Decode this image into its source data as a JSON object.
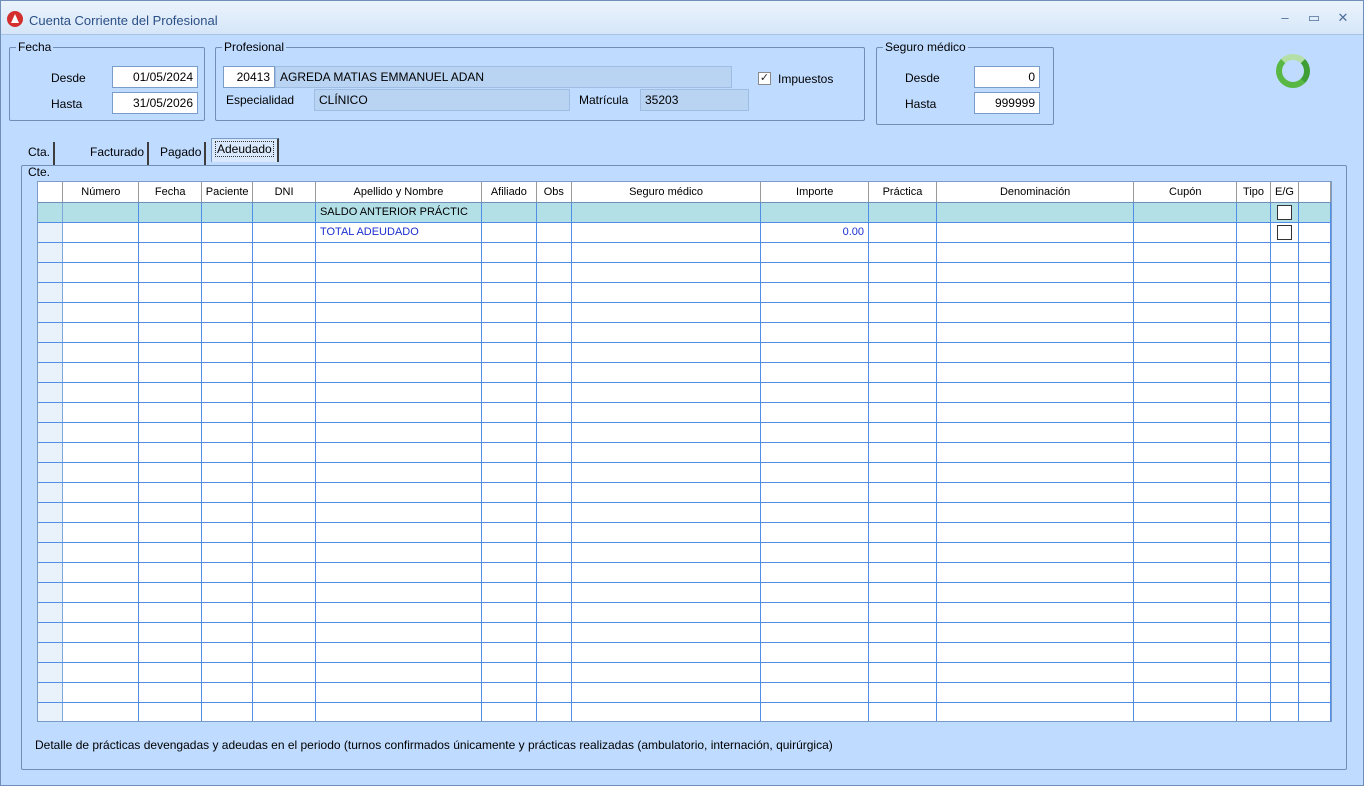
{
  "window": {
    "title": "Cuenta Corriente del Profesional",
    "controls": {
      "minimize": "–",
      "maximize": "▭",
      "close": "✕"
    }
  },
  "fecha": {
    "title": "Fecha",
    "desde_label": "Desde",
    "desde_value": "01/05/2024",
    "hasta_label": "Hasta",
    "hasta_value": "31/05/2026"
  },
  "profesional": {
    "title": "Profesional",
    "codigo": "20413",
    "nombre": "AGREDA MATIAS EMMANUEL ADAN",
    "impuestos_label": "Impuestos",
    "impuestos_checked": true,
    "especialidad_label": "Especialidad",
    "especialidad_value": "CLÍNICO",
    "matricula_label": "Matrícula",
    "matricula_value": "35203"
  },
  "seguro": {
    "title": "Seguro médico",
    "desde_label": "Desde",
    "desde_value": "0",
    "hasta_label": "Hasta",
    "hasta_value": "999999"
  },
  "tabs": [
    {
      "label": "Cta. Cte.",
      "active": false
    },
    {
      "label": "Facturado",
      "active": false
    },
    {
      "label": "Pagado",
      "active": false
    },
    {
      "label": "Adeudado",
      "active": true
    }
  ],
  "grid": {
    "columns": [
      "Número",
      "Fecha",
      "Paciente",
      "DNI",
      "Apellido y Nombre",
      "Afiliado",
      "Obs",
      "Seguro médico",
      "Importe",
      "Práctica",
      "Denominación",
      "Cupón",
      "Tipo",
      "E/G"
    ],
    "rows": [
      {
        "apellido": "SALDO ANTERIOR PRÁCTIC",
        "importe": "",
        "eg_checked": false
      },
      {
        "apellido": "TOTAL ADEUDADO",
        "importe": "0.00",
        "eg_checked": false
      }
    ]
  },
  "footer": {
    "note": "Detalle de prácticas devengadas y adeudas en el periodo (turnos confirmados únicamente y prácticas realizadas (ambulatorio, internación, quirúrgica)"
  },
  "icons": {
    "app": "app-logo-icon",
    "spinner": "refresh-spinner-icon"
  },
  "colors": {
    "background": "#bfdbff",
    "selected_row": "#b3dfe7",
    "total_text": "#1a2fd0",
    "grid_lines": "#4f8de6"
  }
}
